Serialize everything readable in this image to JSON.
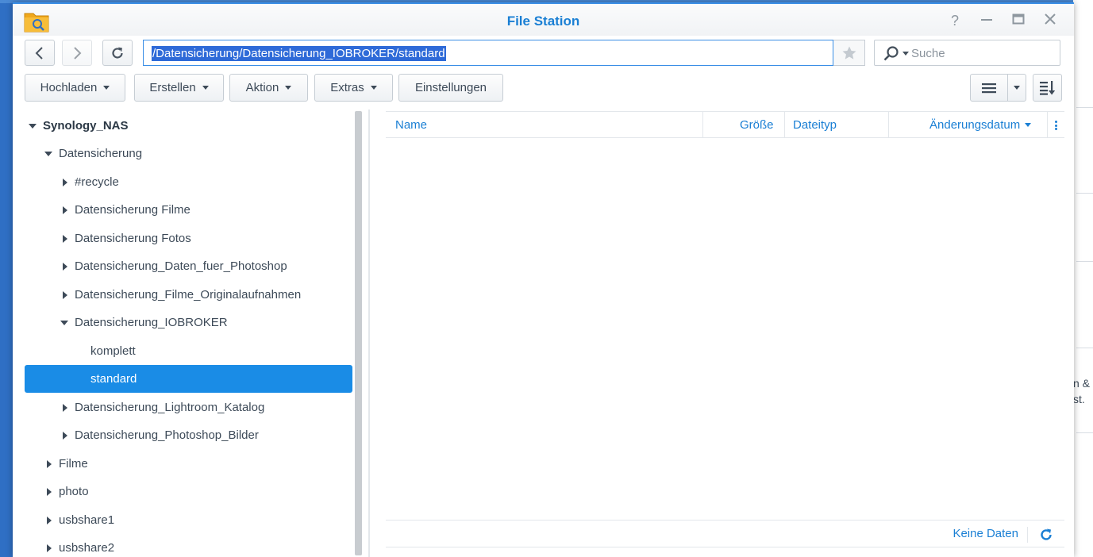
{
  "window": {
    "title": "File Station",
    "controls": {
      "help": "?",
      "minimize": "—",
      "maximize": "▭",
      "close": "✕"
    }
  },
  "navigation": {
    "path": "/Datensicherung/Datensicherung_IOBROKER/standard",
    "search": {
      "placeholder": "Suche"
    }
  },
  "toolbar": {
    "upload_label": "Hochladen",
    "create_label": "Erstellen",
    "action_label": "Aktion",
    "extras_label": "Extras",
    "settings_label": "Einstellungen"
  },
  "tree": {
    "root": "Synology_NAS",
    "items": [
      {
        "label": "Datensicherung"
      },
      {
        "label": "#recycle"
      },
      {
        "label": "Datensicherung Filme"
      },
      {
        "label": "Datensicherung Fotos"
      },
      {
        "label": "Datensicherung_Daten_fuer_Photoshop"
      },
      {
        "label": "Datensicherung_Filme_Originalaufnahmen"
      },
      {
        "label": "Datensicherung_IOBROKER"
      },
      {
        "label": "komplett"
      },
      {
        "label": "standard"
      },
      {
        "label": "Datensicherung_Lightroom_Katalog"
      },
      {
        "label": "Datensicherung_Photoshop_Bilder"
      },
      {
        "label": "Filme"
      },
      {
        "label": "photo"
      },
      {
        "label": "usbshare1"
      },
      {
        "label": "usbshare2"
      }
    ]
  },
  "file_list": {
    "columns": {
      "name": "Name",
      "size": "Größe",
      "type": "Dateityp",
      "modified": "Änderungsdatum"
    },
    "empty_text": "Keine Daten"
  },
  "background": {
    "fragment_1": "n &",
    "fragment_2": "st."
  },
  "colors": {
    "accent": "#1a7fd4",
    "selection": "#1a8ce6",
    "path_highlight": "#2e6ad8",
    "desktop": "#2f6fc4"
  }
}
